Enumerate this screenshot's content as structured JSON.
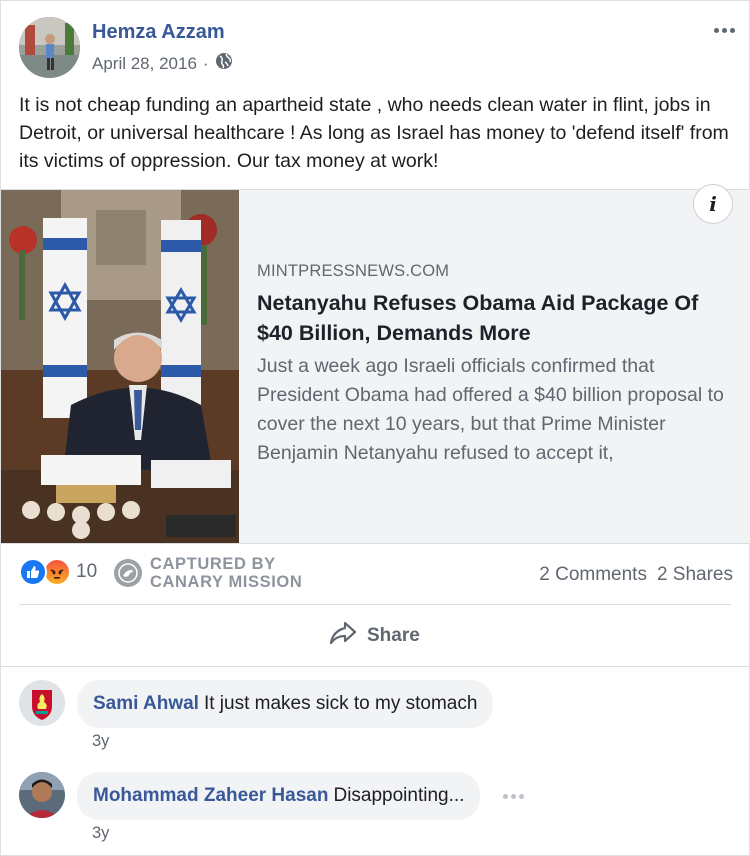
{
  "post": {
    "author": "Hemza Azzam",
    "date": "April 28, 2016",
    "separator": "·",
    "privacy_icon": "globe-icon",
    "text": "It is not cheap funding an apartheid state , who needs clean water in flint, jobs in Detroit, or universal healthcare ! As long as Israel has money to 'defend itself' from its victims of oppression. Our tax money at work!"
  },
  "link": {
    "domain": "MINTPRESSNEWS.COM",
    "title": "Netanyahu Refuses Obama Aid Package Of $40 Billion, Demands More",
    "description": "Just a week ago Israeli officials confirmed that President Obama had offered a $40 billion proposal to cover the next 10 years, but that Prime Minister Benjamin Netanyahu refused to accept it,",
    "info_glyph": "i"
  },
  "engagement": {
    "reaction_icons": [
      "like-icon",
      "angry-icon"
    ],
    "reaction_count": "10",
    "watermark_line1": "CAPTURED BY",
    "watermark_line2": "CANARY MISSION",
    "comments": "2 Comments",
    "shares": "2 Shares"
  },
  "actions": {
    "share_label": "Share"
  },
  "comments": [
    {
      "name": "Sami Ahwal",
      "text": "It just makes sick to my stomach",
      "time": "3y"
    },
    {
      "name": "Mohammad Zaheer Hasan",
      "text": "Disappointing...",
      "time": "3y"
    }
  ],
  "colors": {
    "name_blue": "#385898",
    "meta_gray": "#606770",
    "like_blue": "#1877f2",
    "preview_bg": "#f2f3f5"
  }
}
